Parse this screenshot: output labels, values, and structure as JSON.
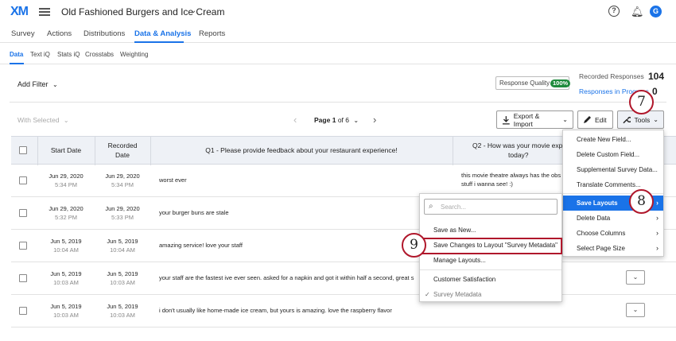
{
  "header": {
    "logo": "XM",
    "project_title": "Old Fashioned Burgers and Ice Cream",
    "help": "?",
    "avatar_letter": "G"
  },
  "main_nav": [
    "Survey",
    "Actions",
    "Distributions",
    "Data & Analysis",
    "Reports"
  ],
  "sub_nav": [
    "Data",
    "Text iQ",
    "Stats iQ",
    "Crosstabs",
    "Weighting"
  ],
  "toolbar": {
    "add_filter": "Add Filter",
    "response_quality": "Response Quality",
    "response_quality_badge": "100%",
    "recorded_label": "Recorded Responses",
    "recorded_value": "104",
    "progress_label": "Responses in Progress",
    "progress_value": "0",
    "with_selected": "With Selected",
    "page_prefix": "Page",
    "page_current": "1",
    "page_of": "of 6",
    "export_import": "Export & Import",
    "edit": "Edit",
    "tools": "Tools"
  },
  "table": {
    "headers": {
      "start_date": "Start Date",
      "recorded_date_1": "Recorded",
      "recorded_date_2": "Date",
      "q1": "Q1 - Please provide feedback about your restaurant experience!",
      "q2_1": "Q2 - How was your movie exp",
      "q2_2": "today?"
    },
    "rows": [
      {
        "start_date": "Jun 29, 2020",
        "start_time": "5:34 PM",
        "rec_date": "Jun 29, 2020",
        "rec_time": "5:34 PM",
        "q1": "worst ever",
        "q2_1": "this movie theatre always has the obs",
        "q2_2": "stuff i wanna see! :)"
      },
      {
        "start_date": "Jun 29, 2020",
        "start_time": "5:32 PM",
        "rec_date": "Jun 29, 2020",
        "rec_time": "5:33 PM",
        "q1": "your burger buns are stale",
        "q2_1": "",
        "q2_2": ""
      },
      {
        "start_date": "Jun 5, 2019",
        "start_time": "10:04 AM",
        "rec_date": "Jun 5, 2019",
        "rec_time": "10:04 AM",
        "q1": "amazing service! love your staff",
        "q2_1": "",
        "q2_2": ""
      },
      {
        "start_date": "Jun 5, 2019",
        "start_time": "10:03 AM",
        "rec_date": "Jun 5, 2019",
        "rec_time": "10:03 AM",
        "q1": "your staff are the fastest ive ever seen. asked for a napkin and got it within half a second, great s",
        "q2_1": "",
        "q2_2": ""
      },
      {
        "start_date": "Jun 5, 2019",
        "start_time": "10:03 AM",
        "rec_date": "Jun 5, 2019",
        "rec_time": "10:03 AM",
        "q1": "i don't usually like home-made ice cream, but yours is amazing. love the raspberry flavor",
        "q2_1": "",
        "q2_2": ""
      }
    ]
  },
  "tools_menu": {
    "items": [
      "Create New Field...",
      "Delete Custom Field...",
      "Supplemental Survey Data...",
      "Translate Comments...",
      "Save Layouts",
      "Delete Data",
      "Choose Columns",
      "Select Page Size"
    ]
  },
  "save_layouts_menu": {
    "search_placeholder": "Search...",
    "save_as_new": "Save as New...",
    "save_changes": "Save Changes to Layout \"Survey Metadata\"",
    "manage": "Manage Layouts...",
    "layout_1": "Customer Satisfaction",
    "layout_2": "Survey Metadata"
  },
  "callouts": [
    "7",
    "8",
    "9"
  ],
  "colors": {
    "accent": "#1a73e8",
    "callout": "#b0172b",
    "badge_green": "#1e8a3c"
  }
}
